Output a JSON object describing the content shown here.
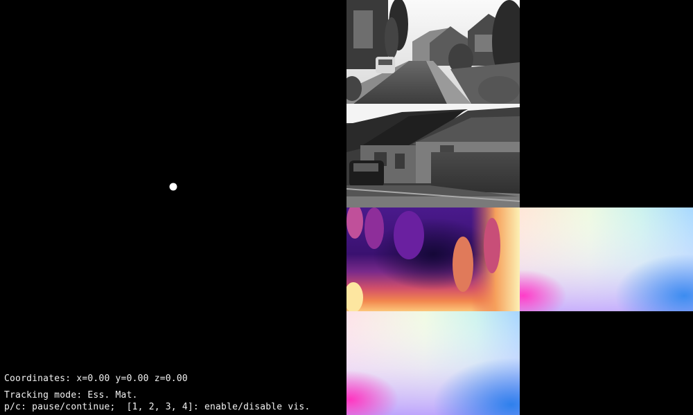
{
  "hud": {
    "coordinates": "Coordinates: x=0.00 y=0.00 z=0.00",
    "tracking_mode": "Tracking mode: Ess. Mat.",
    "help": "p/c: pause/continue;  [1, 2, 3, 4]: enable/disable vis."
  },
  "colors": {
    "background": "#000000",
    "text": "#f2f2f2",
    "trajectory_point": "#ffffff"
  },
  "panels": [
    {
      "name": "camera-frame-front",
      "kind": "grayscale image"
    },
    {
      "name": "camera-frame-side",
      "kind": "grayscale image"
    },
    {
      "name": "depth-map",
      "kind": "magma colormap"
    },
    {
      "name": "optical-flow",
      "kind": "flow color wheel"
    },
    {
      "name": "optical-flow",
      "kind": "flow color wheel"
    }
  ]
}
